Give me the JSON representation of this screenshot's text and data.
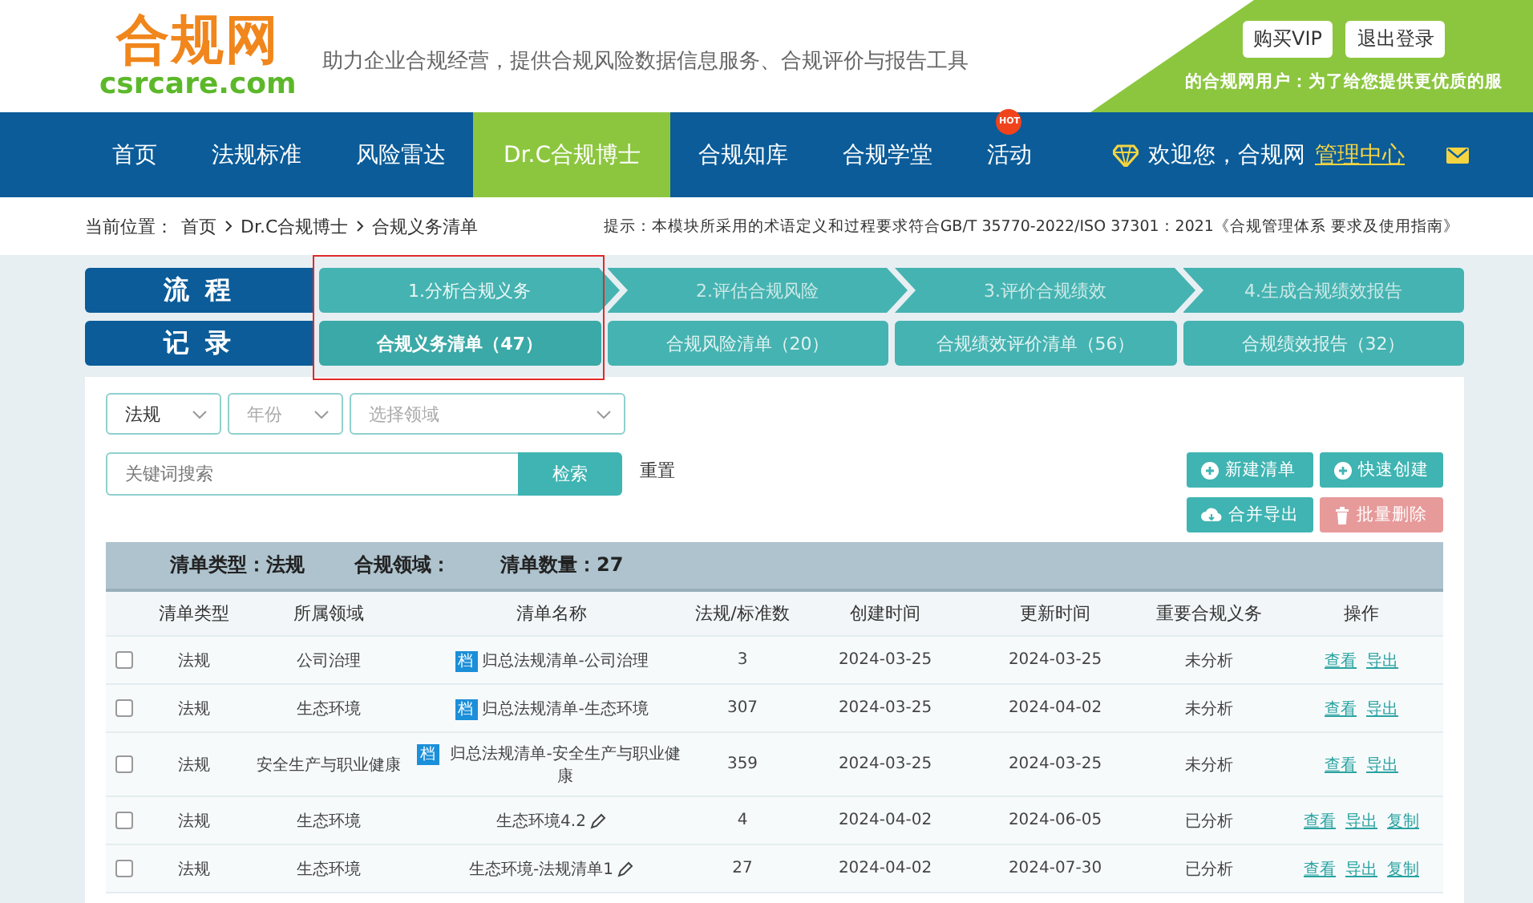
{
  "header": {
    "logo": {
      "name": "合规网",
      "domain": "csrcare.com"
    },
    "slogan": "助力企业合规经营，提供合规风险数据信息服务、合规评价与报告工具",
    "buttons": [
      "购买VIP",
      "退出登录"
    ],
    "notice": "的合规网用户：为了给您提供更优质的服"
  },
  "nav": {
    "items": [
      {
        "label": "首页",
        "selected": false
      },
      {
        "label": "法规标准",
        "selected": false
      },
      {
        "label": "风险雷达",
        "selected": false
      },
      {
        "label": "Dr.C合规博士",
        "selected": true
      },
      {
        "label": "合规知库",
        "selected": false
      },
      {
        "label": "合规学堂",
        "selected": false
      },
      {
        "label": "活动",
        "selected": false,
        "badge": "HOT"
      }
    ],
    "welcome": "欢迎您，合规网",
    "admin_link": "管理中心"
  },
  "breadcrumb": {
    "label": "当前位置：",
    "items": [
      "首页",
      "Dr.C合规博士",
      "合规义务清单"
    ],
    "hint": "提示：本模块所采用的术语定义和过程要求符合GB/T 35770-2022/ISO 37301：2021《合规管理体系 要求及使用指南》"
  },
  "process": {
    "flow_label": "流 程",
    "steps": [
      {
        "label": "1.分析合规义务",
        "selected": true
      },
      {
        "label": "2.评估合规风险",
        "selected": false
      },
      {
        "label": "3.评价合规绩效",
        "selected": false
      },
      {
        "label": "4.生成合规绩效报告",
        "selected": false
      }
    ],
    "record_label": "记 录",
    "records": [
      {
        "label": "合规义务清单（47）",
        "selected": true
      },
      {
        "label": "合规风险清单（20）",
        "selected": false
      },
      {
        "label": "合规绩效评价清单（56）",
        "selected": false
      },
      {
        "label": "合规绩效报告（32）",
        "selected": false
      }
    ],
    "highlight": true
  },
  "filters": {
    "selects": [
      {
        "value": "法规"
      },
      {
        "placeholder": "年份"
      },
      {
        "placeholder": "选择领域"
      }
    ],
    "search": {
      "placeholder": "关键词搜索"
    },
    "search_button": "检索",
    "reset": "重置",
    "actions": [
      {
        "label": "新建清单",
        "kind": "add"
      },
      {
        "label": "快速创建",
        "kind": "add"
      },
      {
        "label": "合并导出",
        "kind": "export"
      },
      {
        "label": "批量删除",
        "kind": "delete"
      }
    ]
  },
  "summary": [
    "清单类型：法规",
    "合规领域：",
    "清单数量：27"
  ],
  "table": {
    "columns": [
      "清单类型",
      "所属领域",
      "清单名称",
      "法规/标准数",
      "创建时间",
      "更新时间",
      "重要合规义务",
      "操作"
    ],
    "rows": [
      {
        "checked": false,
        "type": "法规",
        "domain": "公司治理",
        "tag": "档",
        "name": "归总法规清单-公司治理",
        "editable": false,
        "count": "3",
        "created": "2024-03-25",
        "updated": "2024-03-25",
        "status": "未分析",
        "actions": [
          "查看",
          "导出"
        ]
      },
      {
        "checked": false,
        "type": "法规",
        "domain": "生态环境",
        "tag": "档",
        "name": "归总法规清单-生态环境",
        "editable": false,
        "count": "307",
        "created": "2024-03-25",
        "updated": "2024-04-02",
        "status": "未分析",
        "actions": [
          "查看",
          "导出"
        ]
      },
      {
        "checked": false,
        "type": "法规",
        "domain": "安全生产与职业健康",
        "tag": "档",
        "name": "归总法规清单-安全生产与职业健康",
        "editable": false,
        "count": "359",
        "created": "2024-03-25",
        "updated": "2024-03-25",
        "status": "未分析",
        "actions": [
          "查看",
          "导出"
        ]
      },
      {
        "checked": false,
        "type": "法规",
        "domain": "生态环境",
        "name": "生态环境4.2",
        "editable": true,
        "count": "4",
        "created": "2024-04-02",
        "updated": "2024-06-05",
        "status": "已分析",
        "actions": [
          "查看",
          "导出",
          "复制"
        ]
      },
      {
        "checked": false,
        "type": "法规",
        "domain": "生态环境",
        "name": "生态环境-法规清单1",
        "editable": true,
        "count": "27",
        "created": "2024-04-02",
        "updated": "2024-07-30",
        "status": "已分析",
        "actions": [
          "查看",
          "导出",
          "复制"
        ]
      }
    ]
  }
}
